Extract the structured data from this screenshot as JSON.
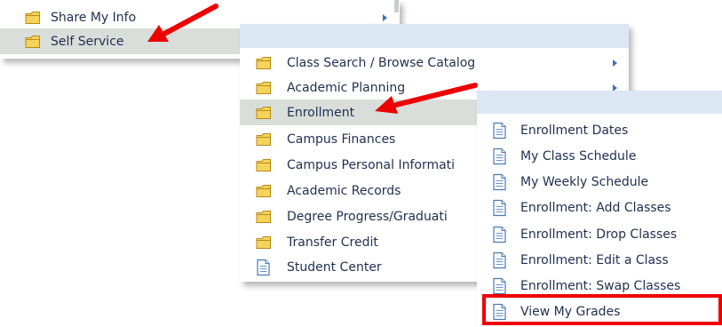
{
  "menu_level1": {
    "items": [
      {
        "label": "Share My Info",
        "icon": "folder-icon",
        "has_submenu": true
      },
      {
        "label": "Self Service",
        "icon": "folder-icon",
        "selected": true
      }
    ]
  },
  "menu_level2": {
    "items": [
      {
        "label": "Class Search / Browse Catalog",
        "icon": "folder-icon",
        "has_submenu": true
      },
      {
        "label": "Academic Planning",
        "icon": "folder-icon",
        "has_submenu": true
      },
      {
        "label": "Enrollment",
        "icon": "folder-icon",
        "selected": true
      },
      {
        "label": "Campus Finances",
        "icon": "folder-icon"
      },
      {
        "label": "Campus Personal Informati",
        "icon": "folder-icon"
      },
      {
        "label": "Academic Records",
        "icon": "folder-icon"
      },
      {
        "label": "Degree Progress/Graduati",
        "icon": "folder-icon"
      },
      {
        "label": "Transfer Credit",
        "icon": "folder-icon"
      },
      {
        "label": "Student Center",
        "icon": "page-icon"
      }
    ]
  },
  "menu_level3": {
    "items": [
      {
        "label": "Enrollment Dates",
        "icon": "page-icon"
      },
      {
        "label": "My Class Schedule",
        "icon": "page-icon"
      },
      {
        "label": "My Weekly Schedule",
        "icon": "page-icon"
      },
      {
        "label": "Enrollment: Add Classes",
        "icon": "page-icon"
      },
      {
        "label": "Enrollment: Drop Classes",
        "icon": "page-icon"
      },
      {
        "label": "Enrollment: Edit a Class",
        "icon": "page-icon"
      },
      {
        "label": "Enrollment: Swap Classes",
        "icon": "page-icon"
      },
      {
        "label": "View My Grades",
        "icon": "page-icon",
        "highlighted": true
      }
    ]
  },
  "annotations": {
    "arrow_color": "#ee0000",
    "highlight_box_color": "#ee0000"
  },
  "colors": {
    "menu_header": "#dbe7f3",
    "selected_row": "#d9dedb",
    "text": "#1f2f4f",
    "folder_fill": "#f6d45a",
    "folder_stroke": "#b58a1a"
  }
}
